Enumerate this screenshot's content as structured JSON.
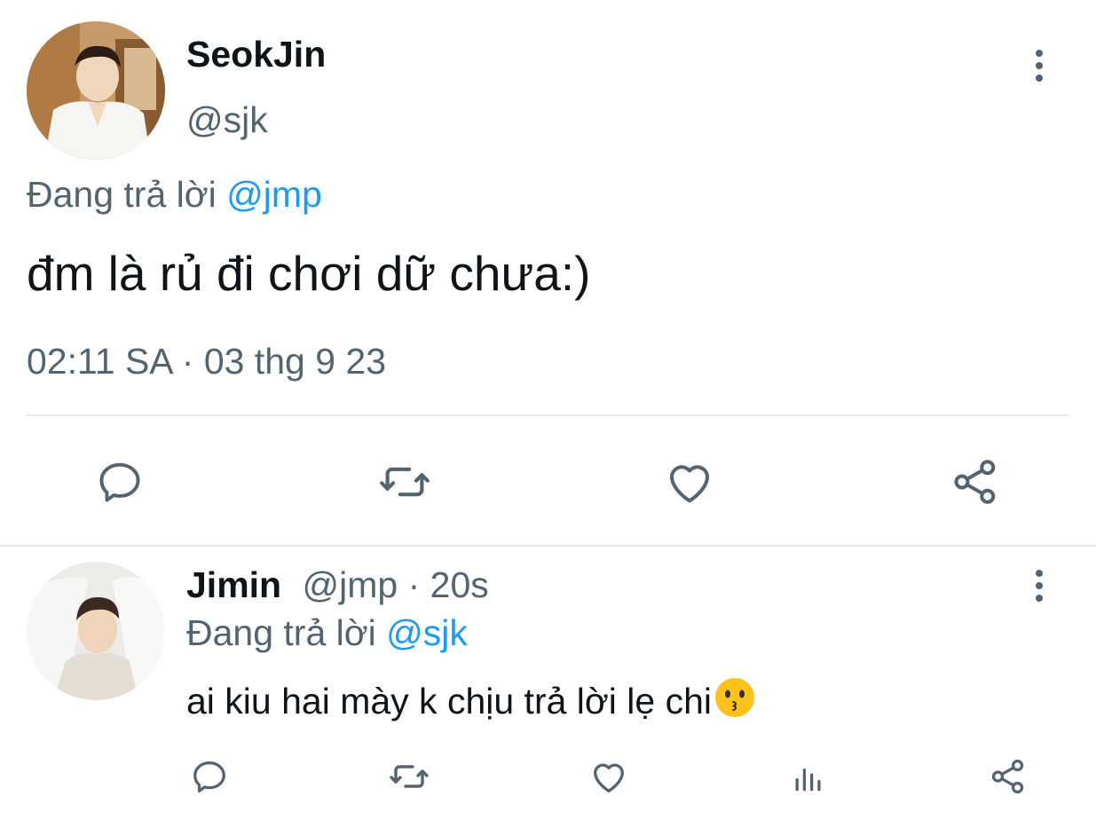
{
  "main_tweet": {
    "display_name": "SeokJin",
    "handle": "@sjk",
    "reply_prefix": "Đang trả lời",
    "reply_to": "@jmp",
    "text": "đm là rủ đi chơi dữ chưa:)",
    "timestamp": "02:11 SA · 03 thg 9 23",
    "actions": [
      "reply-icon",
      "retweet-icon",
      "like-icon",
      "share-icon"
    ]
  },
  "reply_tweet": {
    "display_name": "Jimin",
    "handle": "@jmp",
    "separator": "·",
    "time_ago": "20s",
    "reply_prefix": "Đang trả lời",
    "reply_to": "@sjk",
    "text": "ai kiu hai mày k chịu trả lời lẹ chi",
    "emoji": "kissing-face-emoji",
    "actions": [
      "reply-icon",
      "retweet-icon",
      "like-icon",
      "views-icon",
      "share-icon"
    ]
  },
  "colors": {
    "text": "#0f1419",
    "muted": "#536471",
    "link": "#1d9bf0",
    "divider": "#e6e8ea"
  }
}
